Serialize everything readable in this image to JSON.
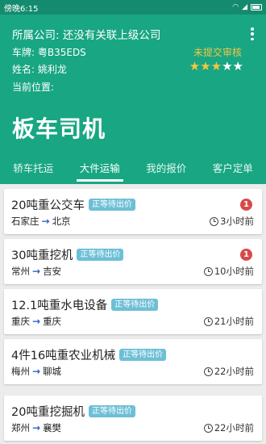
{
  "status_bar": {
    "time": "傍晚6:15",
    "battery_icon": "battery-icon"
  },
  "profile": {
    "company": "所属公司: 还没有关联上级公司",
    "plate": "车牌: 粤B35EDS",
    "audit_status": "未提交审核",
    "name": "姓名: 姚利龙",
    "rating_stars_filled": 3,
    "rating_stars_total": 5,
    "location": "当前位置:",
    "role": "板车司机"
  },
  "colors": {
    "header": "#18a683",
    "statusbar": "#148b6e",
    "star": "#f4c542",
    "badge": "#6dbfd6",
    "unread": "#d84a4a",
    "arrow": "#2a63c8"
  },
  "tabs": [
    {
      "label": "轿车托运",
      "active": false
    },
    {
      "label": "大件运输",
      "active": true
    },
    {
      "label": "我的报价",
      "active": false
    },
    {
      "label": "客户定单",
      "active": false
    }
  ],
  "orders": [
    {
      "title": "20吨重公交车",
      "badge": "正等待出价",
      "unread": "1",
      "from": "石家庄",
      "arrow": "→",
      "to": "北京",
      "time": "3小时前"
    },
    {
      "title": "30吨重挖机",
      "badge": "正等待出价",
      "unread": "1",
      "from": "常州",
      "arrow": "→",
      "to": "吉安",
      "time": "10小时前"
    },
    {
      "title": "12.1吨重水电设备",
      "badge": "正等待出价",
      "unread": "",
      "from": "重庆",
      "arrow": "→",
      "to": "重庆",
      "time": "21小时前"
    },
    {
      "title": "4件16吨重农业机械",
      "badge": "正等待出价",
      "unread": "",
      "from": "梅州",
      "arrow": "→",
      "to": "聊城",
      "time": "22小时前"
    },
    {
      "title": "20吨重挖掘机",
      "badge": "正等待出价",
      "unread": "",
      "from": "郑州",
      "arrow": "→",
      "to": "襄樊",
      "time": "22小时前"
    }
  ]
}
